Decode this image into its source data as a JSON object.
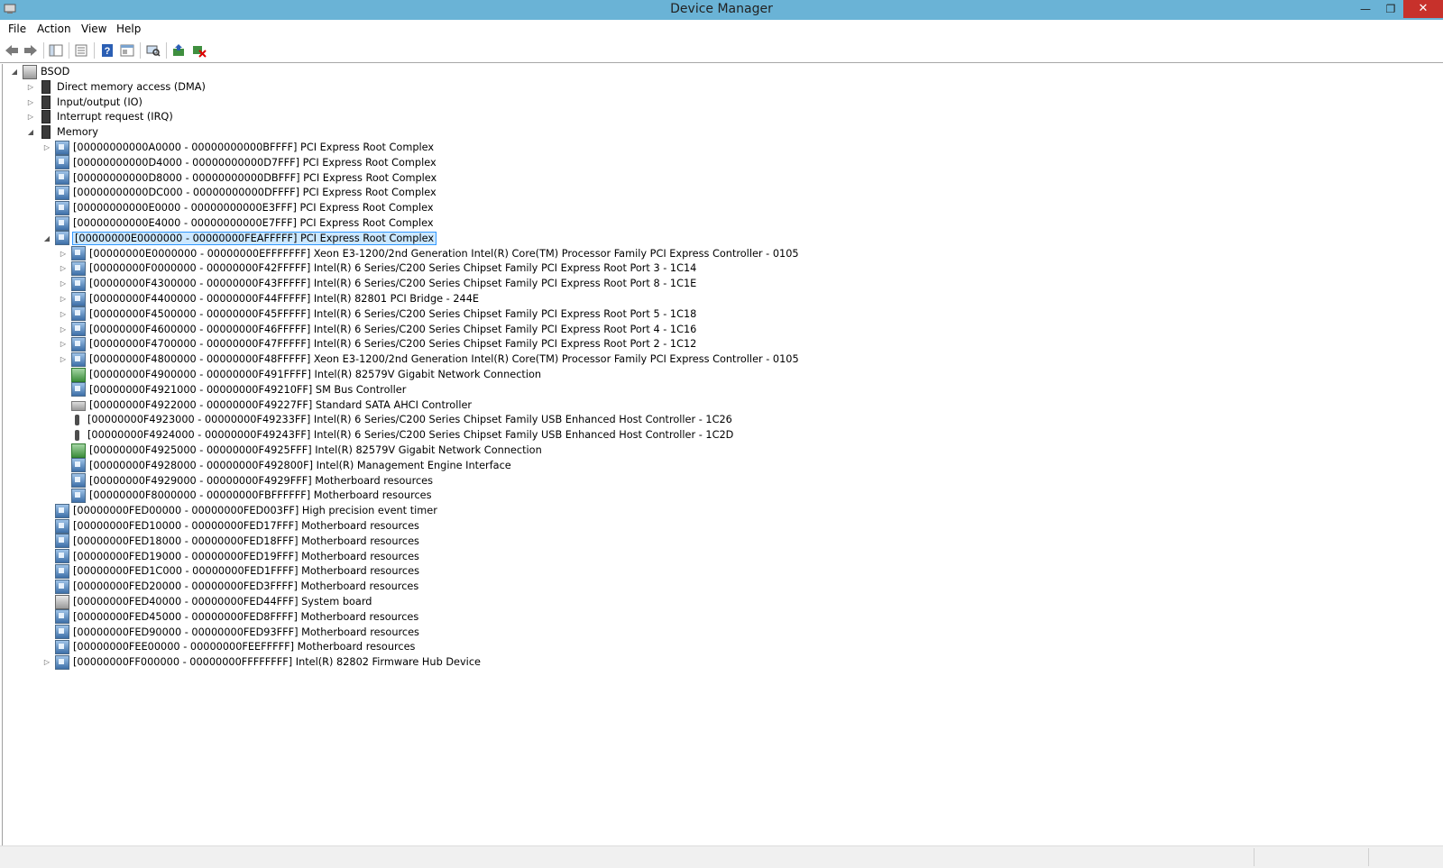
{
  "window": {
    "title": "Device Manager"
  },
  "menu": [
    "File",
    "Action",
    "View",
    "Help"
  ],
  "toolbar": [
    "back-icon",
    "forward-icon",
    "show-hide-console-tree-icon",
    "properties-icon",
    "help-icon",
    "view-icon",
    "scan-hardware-icon",
    "update-driver-icon",
    "uninstall-icon"
  ],
  "tree": {
    "root": "BSOD",
    "nodes": [
      {
        "depth": 1,
        "exp": "collapsed",
        "icon": "chip",
        "text": "Direct memory access (DMA)"
      },
      {
        "depth": 1,
        "exp": "collapsed",
        "icon": "chip",
        "text": "Input/output (IO)"
      },
      {
        "depth": 1,
        "exp": "collapsed",
        "icon": "chip",
        "text": "Interrupt request (IRQ)"
      },
      {
        "depth": 1,
        "exp": "expanded",
        "icon": "chip",
        "text": "Memory"
      },
      {
        "depth": 2,
        "exp": "collapsed",
        "icon": "dev",
        "text": "[00000000000A0000 - 00000000000BFFFF]  PCI Express Root Complex"
      },
      {
        "depth": 2,
        "exp": "none",
        "icon": "dev",
        "text": "[00000000000D4000 - 00000000000D7FFF]  PCI Express Root Complex"
      },
      {
        "depth": 2,
        "exp": "none",
        "icon": "dev",
        "text": "[00000000000D8000 - 00000000000DBFFF]  PCI Express Root Complex"
      },
      {
        "depth": 2,
        "exp": "none",
        "icon": "dev",
        "text": "[00000000000DC000 - 00000000000DFFFF]  PCI Express Root Complex"
      },
      {
        "depth": 2,
        "exp": "none",
        "icon": "dev",
        "text": "[00000000000E0000 - 00000000000E3FFF]  PCI Express Root Complex"
      },
      {
        "depth": 2,
        "exp": "none",
        "icon": "dev",
        "text": "[00000000000E4000 - 00000000000E7FFF]  PCI Express Root Complex"
      },
      {
        "depth": 2,
        "exp": "expanded",
        "icon": "dev",
        "selected": true,
        "text": "[00000000E0000000 - 00000000FEAFFFFF]  PCI Express Root Complex"
      },
      {
        "depth": 3,
        "exp": "collapsed",
        "icon": "dev",
        "text": "[00000000E0000000 - 00000000EFFFFFFF]  Xeon E3-1200/2nd Generation Intel(R) Core(TM) Processor Family PCI Express Controller - 0105"
      },
      {
        "depth": 3,
        "exp": "collapsed",
        "icon": "dev",
        "text": "[00000000F0000000 - 00000000F42FFFFF]  Intel(R) 6 Series/C200 Series Chipset Family PCI Express Root Port 3 - 1C14"
      },
      {
        "depth": 3,
        "exp": "collapsed",
        "icon": "dev",
        "text": "[00000000F4300000 - 00000000F43FFFFF]  Intel(R) 6 Series/C200 Series Chipset Family PCI Express Root Port 8 - 1C1E"
      },
      {
        "depth": 3,
        "exp": "collapsed",
        "icon": "dev",
        "text": "[00000000F4400000 - 00000000F44FFFFF]  Intel(R) 82801 PCI Bridge - 244E"
      },
      {
        "depth": 3,
        "exp": "collapsed",
        "icon": "dev",
        "text": "[00000000F4500000 - 00000000F45FFFFF]  Intel(R) 6 Series/C200 Series Chipset Family PCI Express Root Port 5 - 1C18"
      },
      {
        "depth": 3,
        "exp": "collapsed",
        "icon": "dev",
        "text": "[00000000F4600000 - 00000000F46FFFFF]  Intel(R) 6 Series/C200 Series Chipset Family PCI Express Root Port 4 - 1C16"
      },
      {
        "depth": 3,
        "exp": "collapsed",
        "icon": "dev",
        "text": "[00000000F4700000 - 00000000F47FFFFF]  Intel(R) 6 Series/C200 Series Chipset Family PCI Express Root Port 2 - 1C12"
      },
      {
        "depth": 3,
        "exp": "collapsed",
        "icon": "dev",
        "text": "[00000000F4800000 - 00000000F48FFFFF]  Xeon E3-1200/2nd Generation Intel(R) Core(TM) Processor Family PCI Express Controller - 0105"
      },
      {
        "depth": 3,
        "exp": "none",
        "icon": "net",
        "text": "[00000000F4900000 - 00000000F491FFFF]  Intel(R) 82579V Gigabit Network Connection"
      },
      {
        "depth": 3,
        "exp": "none",
        "icon": "dev",
        "text": "[00000000F4921000 - 00000000F49210FF]  SM Bus Controller"
      },
      {
        "depth": 3,
        "exp": "none",
        "icon": "sata",
        "text": "[00000000F4922000 - 00000000F49227FF]  Standard SATA AHCI Controller"
      },
      {
        "depth": 3,
        "exp": "none",
        "icon": "usb",
        "text": "[00000000F4923000 - 00000000F49233FF]  Intel(R) 6 Series/C200 Series Chipset Family USB Enhanced Host Controller - 1C26"
      },
      {
        "depth": 3,
        "exp": "none",
        "icon": "usb",
        "text": "[00000000F4924000 - 00000000F49243FF]  Intel(R) 6 Series/C200 Series Chipset Family USB Enhanced Host Controller - 1C2D"
      },
      {
        "depth": 3,
        "exp": "none",
        "icon": "net",
        "text": "[00000000F4925000 - 00000000F4925FFF]  Intel(R) 82579V Gigabit Network Connection"
      },
      {
        "depth": 3,
        "exp": "none",
        "icon": "dev",
        "text": "[00000000F4928000 - 00000000F492800F]  Intel(R) Management Engine Interface"
      },
      {
        "depth": 3,
        "exp": "none",
        "icon": "dev",
        "text": "[00000000F4929000 - 00000000F4929FFF]  Motherboard resources"
      },
      {
        "depth": 3,
        "exp": "none",
        "icon": "dev",
        "text": "[00000000F8000000 - 00000000FBFFFFFF]  Motherboard resources"
      },
      {
        "depth": 2,
        "exp": "none",
        "icon": "dev",
        "text": "[00000000FED00000 - 00000000FED003FF]  High precision event timer"
      },
      {
        "depth": 2,
        "exp": "none",
        "icon": "dev",
        "text": "[00000000FED10000 - 00000000FED17FFF]  Motherboard resources"
      },
      {
        "depth": 2,
        "exp": "none",
        "icon": "dev",
        "text": "[00000000FED18000 - 00000000FED18FFF]  Motherboard resources"
      },
      {
        "depth": 2,
        "exp": "none",
        "icon": "dev",
        "text": "[00000000FED19000 - 00000000FED19FFF]  Motherboard resources"
      },
      {
        "depth": 2,
        "exp": "none",
        "icon": "dev",
        "text": "[00000000FED1C000 - 00000000FED1FFFF]  Motherboard resources"
      },
      {
        "depth": 2,
        "exp": "none",
        "icon": "dev",
        "text": "[00000000FED20000 - 00000000FED3FFFF]  Motherboard resources"
      },
      {
        "depth": 2,
        "exp": "none",
        "icon": "pc",
        "text": "[00000000FED40000 - 00000000FED44FFF]  System board"
      },
      {
        "depth": 2,
        "exp": "none",
        "icon": "dev",
        "text": "[00000000FED45000 - 00000000FED8FFFF]  Motherboard resources"
      },
      {
        "depth": 2,
        "exp": "none",
        "icon": "dev",
        "text": "[00000000FED90000 - 00000000FED93FFF]  Motherboard resources"
      },
      {
        "depth": 2,
        "exp": "none",
        "icon": "dev",
        "text": "[00000000FEE00000 - 00000000FEEFFFFF]  Motherboard resources"
      },
      {
        "depth": 2,
        "exp": "collapsed",
        "icon": "dev",
        "text": "[00000000FF000000 - 00000000FFFFFFFF]  Intel(R) 82802 Firmware Hub Device"
      }
    ]
  },
  "colors": {
    "titlebar": "#6ab3d6",
    "close": "#c7312b",
    "selection": "#cce8ff",
    "selection_border": "#3399ff"
  }
}
